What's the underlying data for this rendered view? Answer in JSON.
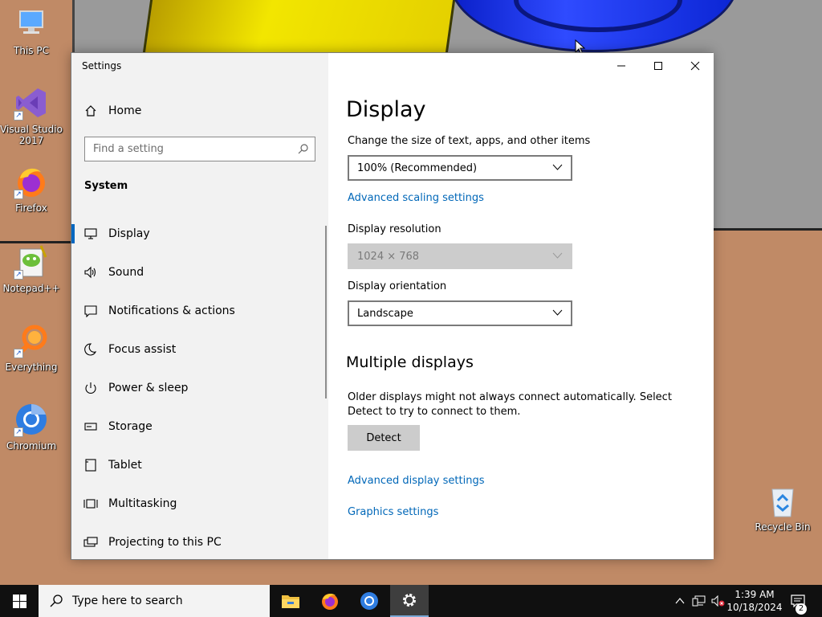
{
  "desktop": {
    "icons": [
      {
        "label": "This PC",
        "icon": "this-pc-icon"
      },
      {
        "label": "Visual Studio 2017",
        "icon": "visual-studio-icon"
      },
      {
        "label": "Firefox",
        "icon": "firefox-icon"
      },
      {
        "label": "Notepad++",
        "icon": "notepadpp-icon"
      },
      {
        "label": "Everything",
        "icon": "everything-icon"
      },
      {
        "label": "Chromium",
        "icon": "chromium-icon"
      },
      {
        "label": "Recycle Bin",
        "icon": "recycle-bin-icon"
      }
    ]
  },
  "window": {
    "title": "Settings",
    "accent": "#0067c0",
    "link_color": "#0067b8"
  },
  "sidebar": {
    "home_label": "Home",
    "search_placeholder": "Find a setting",
    "section": "System",
    "items": [
      {
        "label": "Display",
        "icon": "monitor-icon",
        "active": true
      },
      {
        "label": "Sound",
        "icon": "speaker-icon"
      },
      {
        "label": "Notifications & actions",
        "icon": "notification-icon"
      },
      {
        "label": "Focus assist",
        "icon": "moon-icon"
      },
      {
        "label": "Power & sleep",
        "icon": "power-icon"
      },
      {
        "label": "Storage",
        "icon": "storage-icon"
      },
      {
        "label": "Tablet",
        "icon": "tablet-icon"
      },
      {
        "label": "Multitasking",
        "icon": "multitasking-icon"
      },
      {
        "label": "Projecting to this PC",
        "icon": "projecting-icon"
      }
    ]
  },
  "main": {
    "title": "Display",
    "scale_label": "Change the size of text, apps, and other items",
    "scale_value": "100% (Recommended)",
    "advanced_scaling_link": "Advanced scaling settings",
    "resolution_label": "Display resolution",
    "resolution_value": "1024 × 768",
    "orientation_label": "Display orientation",
    "orientation_value": "Landscape",
    "multiple_title": "Multiple displays",
    "multiple_desc": "Older displays might not always connect automatically. Select Detect to try to connect to them.",
    "detect_button": "Detect",
    "advanced_display_link": "Advanced display settings",
    "graphics_link": "Graphics settings"
  },
  "taskbar": {
    "search_placeholder": "Type here to search",
    "apps": [
      "file-explorer-icon",
      "firefox-icon",
      "chromium-icon",
      "settings-gear-icon"
    ],
    "time": "1:39 AM",
    "date": "10/18/2024",
    "notification_count": "2"
  }
}
